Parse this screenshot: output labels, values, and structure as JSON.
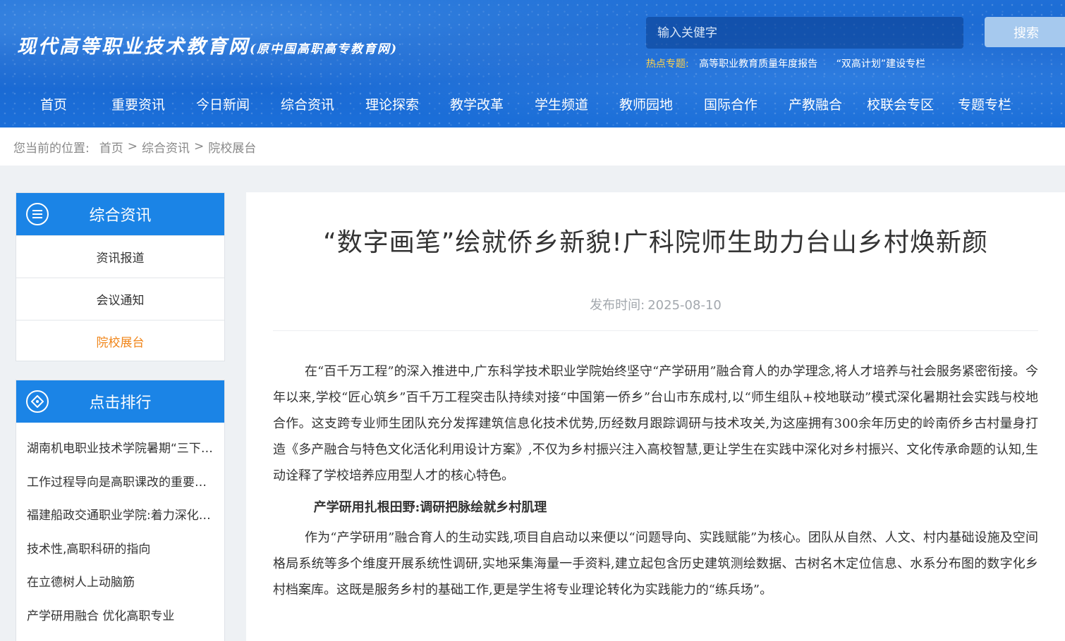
{
  "site": {
    "logo_main": "现代高等职业技术教育网",
    "logo_sub": "(原中国高职高专教育网)"
  },
  "search": {
    "placeholder": "输入关健字",
    "button": "搜索"
  },
  "hot_topics": {
    "label": "热点专题:",
    "items": [
      "高等职业教育质量年度报告",
      "“双高计划”建设专栏"
    ]
  },
  "nav": [
    "首页",
    "重要资讯",
    "今日新闻",
    "综合资讯",
    "理论探索",
    "教学改革",
    "学生频道",
    "教师园地",
    "国际合作",
    "产教融合",
    "校联会专区",
    "专题专栏"
  ],
  "breadcrumb": {
    "prefix": "您当前的位置:",
    "items": [
      "首页",
      ">",
      "综合资讯",
      ">",
      "院校展台"
    ]
  },
  "sidebar_category": {
    "title": "综合资讯",
    "items": [
      "资讯报道",
      "会议通知",
      "院校展台"
    ],
    "active": "院校展台"
  },
  "sidebar_rank": {
    "title": "点击排行",
    "items": [
      "湖南机电职业技术学院暑期“三下乡”",
      "工作过程导向是高职课改的重要方向",
      "福建船政交通职业学院:着力深化改革",
      "技术性,高职科研的指向",
      "在立德树人上动脑筋",
      "产学研用融合 优化高职专业"
    ]
  },
  "article": {
    "title": "“数字画笔”绘就侨乡新貌!广科院师生助力台山乡村焕新颜",
    "date_label": "发布时间:",
    "date": "2025-08-10",
    "para1": "在“百千万工程”的深入推进中,广东科学技术职业学院始终坚守“产学研用”融合育人的办学理念,将人才培养与社会服务紧密衔接。今年以来,学校“匠心筑乡”百千万工程突击队持续对接“中国第一侨乡”台山市东成村,以“师生组队+校地联动”模式深化暑期社会实践与校地合作。这支跨专业师生团队充分发挥建筑信息化技术优势,历经数月跟踪调研与技术攻关,为这座拥有300余年历史的岭南侨乡古村量身打造《多产融合与特色文化活化利用设计方案》,不仅为乡村振兴注入高校智慧,更让学生在实践中深化对乡村振兴、文化传承命题的认知,生动诠释了学校培养应用型人才的核心特色。",
    "subhead": "产学研用扎根田野:调研把脉绘就乡村肌理",
    "para2": "作为“产学研用”融合育人的生动实践,项目自启动以来便以“问题导向、实践赋能”为核心。团队从自然、人文、村内基础设施及空间格局系统等多个维度开展系统性调研,实地采集海量一手资料,建立起包含历史建筑测绘数据、古树名木定位信息、水系分布图的数字化乡村档案库。这既是服务乡村的基础工作,更是学生将专业理论转化为实践能力的“练兵场”。"
  },
  "colors": {
    "header_blue": "#1a66cf",
    "side_blue": "#1b84e6",
    "active_orange": "#f08519",
    "hot_yellow": "#ffd24a"
  }
}
